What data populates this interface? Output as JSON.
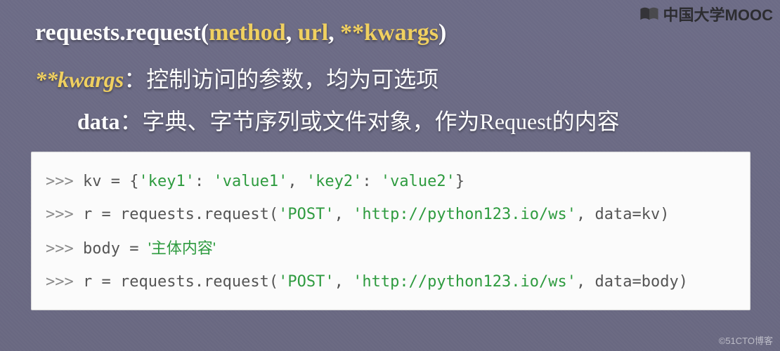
{
  "watermark": {
    "top_text": "中国大学MOOC",
    "bottom_text": "©51CTO博客"
  },
  "signature": {
    "prefix": "requests.request(",
    "arg1": "method",
    "sep1": ", ",
    "arg2": "url",
    "sep2": ", ",
    "arg3": "**kwargs",
    "suffix": ")"
  },
  "desc1": {
    "label": "**kwargs",
    "colon": "：",
    "text": "控制访问的参数，均为可选项"
  },
  "desc2": {
    "label": "data",
    "colon": "：",
    "text": "字典、字节序列或文件对象，作为Request的内容"
  },
  "code": {
    "l1": {
      "prompt": ">>> ",
      "a": "kv = {",
      "s1": "'key1'",
      "b": ": ",
      "s2": "'value1'",
      "c": ", ",
      "s3": "'key2'",
      "d": ": ",
      "s4": "'value2'",
      "e": "}"
    },
    "l2": {
      "prompt": ">>> ",
      "a": "r = requests.request(",
      "s1": "'POST'",
      "b": ", ",
      "s2": "'http://python123.io/ws'",
      "c": ", data=kv)"
    },
    "l3": {
      "prompt": ">>> ",
      "a": "body = ",
      "s1": "'主体内容'"
    },
    "l4": {
      "prompt": ">>> ",
      "a": "r = requests.request(",
      "s1": "'POST'",
      "b": ", ",
      "s2": "'http://python123.io/ws'",
      "c": ", data=body)"
    }
  }
}
